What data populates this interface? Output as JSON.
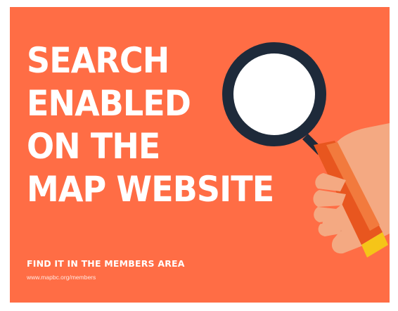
{
  "headline": {
    "line1": "SEARCH",
    "line2": "ENABLED",
    "line3": "ON THE",
    "line4": "MAP WEBSITE"
  },
  "call_to_action": "FIND IT IN THE MEMBERS AREA",
  "url": "www.mapbc.org/members",
  "illustration": {
    "icon": "magnifying-glass-icon",
    "hand_icon": "hand-icon"
  },
  "colors": {
    "background": "#ff6d45",
    "text": "#ffffff",
    "lens_ring": "#1e2a3a",
    "handle": "#e8561f",
    "handle_cap": "#f5c518",
    "skin": "#f4a982"
  }
}
